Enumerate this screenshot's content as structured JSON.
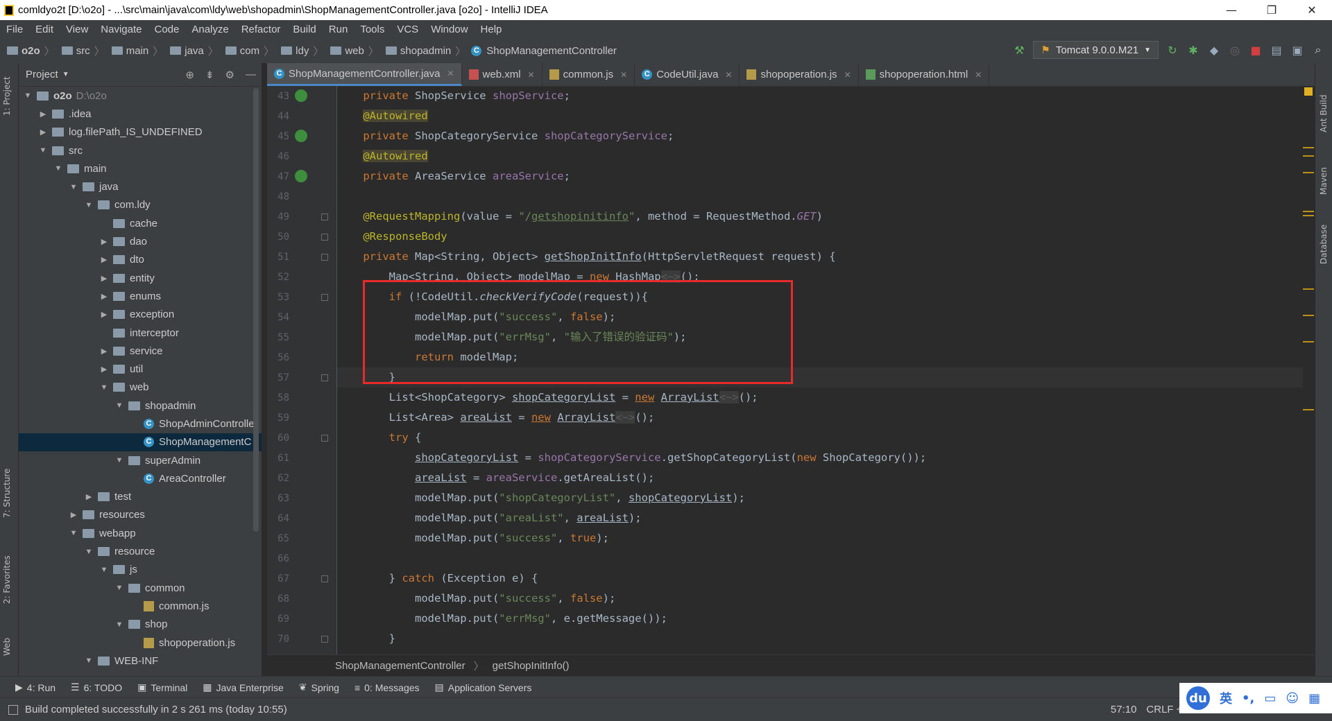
{
  "window": {
    "title": "comldyo2t [D:\\o2o] - ...\\src\\main\\java\\com\\ldy\\web\\shopadmin\\ShopManagementController.java [o2o] - IntelliJ IDEA",
    "minimize": "—",
    "maximize": "❐",
    "close": "✕"
  },
  "menu": [
    "File",
    "Edit",
    "View",
    "Navigate",
    "Code",
    "Analyze",
    "Refactor",
    "Build",
    "Run",
    "Tools",
    "VCS",
    "Window",
    "Help"
  ],
  "nav": {
    "crumbs": [
      "o2o",
      "src",
      "main",
      "java",
      "com",
      "ldy",
      "web",
      "shopadmin",
      "ShopManagementController"
    ],
    "run_config": "Tomcat 9.0.0.M21"
  },
  "left_strip": {
    "project": "1: Project",
    "structure": "7: Structure",
    "favorites": "2: Favorites",
    "web": "Web"
  },
  "right_strip": {
    "ant": "Ant Build",
    "maven": "Maven",
    "database": "Database"
  },
  "project": {
    "header": "Project",
    "tree": [
      {
        "label": "o2o",
        "extra": "D:\\o2o",
        "arrow": "▼",
        "icon": "folder",
        "indent": 0
      },
      {
        "label": ".idea",
        "arrow": "▶",
        "icon": "folder",
        "indent": 1
      },
      {
        "label": "log.filePath_IS_UNDEFINED",
        "arrow": "▶",
        "icon": "folder",
        "indent": 1
      },
      {
        "label": "src",
        "arrow": "▼",
        "icon": "folder",
        "indent": 1
      },
      {
        "label": "main",
        "arrow": "▼",
        "icon": "folder",
        "indent": 2
      },
      {
        "label": "java",
        "arrow": "▼",
        "icon": "folder",
        "indent": 3
      },
      {
        "label": "com.ldy",
        "arrow": "▼",
        "icon": "pkg",
        "indent": 4
      },
      {
        "label": "cache",
        "arrow": "",
        "icon": "pkg",
        "indent": 5
      },
      {
        "label": "dao",
        "arrow": "▶",
        "icon": "pkg",
        "indent": 5
      },
      {
        "label": "dto",
        "arrow": "▶",
        "icon": "pkg",
        "indent": 5
      },
      {
        "label": "entity",
        "arrow": "▶",
        "icon": "pkg",
        "indent": 5
      },
      {
        "label": "enums",
        "arrow": "▶",
        "icon": "pkg",
        "indent": 5
      },
      {
        "label": "exception",
        "arrow": "▶",
        "icon": "pkg",
        "indent": 5
      },
      {
        "label": "interceptor",
        "arrow": "",
        "icon": "pkg",
        "indent": 5
      },
      {
        "label": "service",
        "arrow": "▶",
        "icon": "pkg",
        "indent": 5
      },
      {
        "label": "util",
        "arrow": "▶",
        "icon": "pkg",
        "indent": 5
      },
      {
        "label": "web",
        "arrow": "▼",
        "icon": "pkg",
        "indent": 5
      },
      {
        "label": "shopadmin",
        "arrow": "▼",
        "icon": "pkg",
        "indent": 6
      },
      {
        "label": "ShopAdminController",
        "arrow": "",
        "icon": "class",
        "indent": 7
      },
      {
        "label": "ShopManagementC",
        "arrow": "",
        "icon": "class",
        "indent": 7,
        "selected": true
      },
      {
        "label": "superAdmin",
        "arrow": "▼",
        "icon": "pkg",
        "indent": 6
      },
      {
        "label": "AreaController",
        "arrow": "",
        "icon": "class",
        "indent": 7
      },
      {
        "label": "test",
        "arrow": "▶",
        "icon": "folder",
        "indent": 4
      },
      {
        "label": "resources",
        "arrow": "▶",
        "icon": "folder",
        "indent": 3
      },
      {
        "label": "webapp",
        "arrow": "▼",
        "icon": "folder",
        "indent": 3
      },
      {
        "label": "resource",
        "arrow": "▼",
        "icon": "folder",
        "indent": 4
      },
      {
        "label": "js",
        "arrow": "▼",
        "icon": "folder",
        "indent": 5
      },
      {
        "label": "common",
        "arrow": "▼",
        "icon": "folder",
        "indent": 6
      },
      {
        "label": "common.js",
        "arrow": "",
        "icon": "js",
        "indent": 7
      },
      {
        "label": "shop",
        "arrow": "▼",
        "icon": "folder",
        "indent": 6
      },
      {
        "label": "shopoperation.js",
        "arrow": "",
        "icon": "js",
        "indent": 7
      },
      {
        "label": "WEB-INF",
        "arrow": "▼",
        "icon": "folder",
        "indent": 4
      }
    ]
  },
  "tabs": [
    {
      "label": "ShopManagementController.java",
      "icon": "class",
      "active": true
    },
    {
      "label": "web.xml",
      "icon": "xml"
    },
    {
      "label": "common.js",
      "icon": "js"
    },
    {
      "label": "CodeUtil.java",
      "icon": "class"
    },
    {
      "label": "shopoperation.js",
      "icon": "js"
    },
    {
      "label": "shopoperation.html",
      "icon": "html"
    }
  ],
  "editor": {
    "line_numbers": [
      "43",
      "44",
      "45",
      "46",
      "47",
      "48",
      "49",
      "50",
      "51",
      "52",
      "53",
      "54",
      "55",
      "56",
      "57",
      "58",
      "59",
      "60",
      "61",
      "62",
      "63",
      "64",
      "65",
      "66",
      "67",
      "68",
      "69",
      "70"
    ],
    "breadcrumb": [
      "ShopManagementController",
      "getShopInitInfo()"
    ]
  },
  "toolwindows": [
    "4: Run",
    "6: TODO",
    "Terminal",
    "Java Enterprise",
    "Spring",
    "0: Messages",
    "Application Servers"
  ],
  "status": {
    "message": "Build completed successfully in 2 s 261 ms (today 10:55)",
    "position": "57:10",
    "line_sep": "CRLF ÷"
  },
  "ime": {
    "logo": "du",
    "lang": "英",
    "punct": "•,"
  },
  "colors": {
    "keyword": "#cc7832",
    "annotation": "#bbb529",
    "string": "#6a8759",
    "field": "#9876aa",
    "highlight_box": "#e82a2a"
  }
}
